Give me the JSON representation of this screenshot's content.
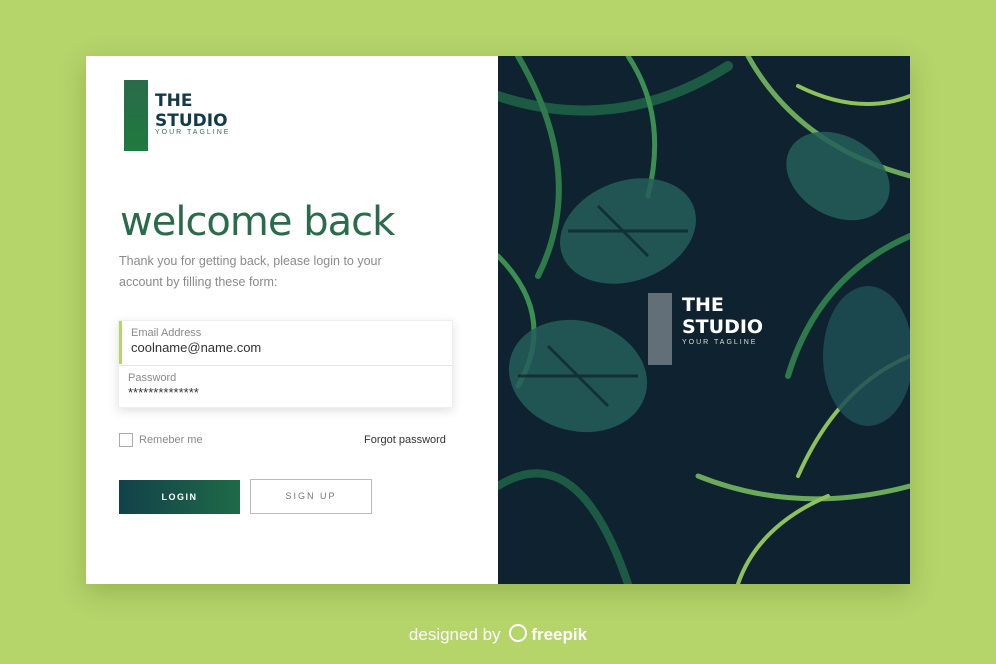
{
  "brand": {
    "title_line1": "THE",
    "title_line2": "STUDIO",
    "tagline": "YOUR TAGLINE"
  },
  "heading": "welcome back",
  "subtitle": "Thank you for getting back, please login to your account by filling these form:",
  "form": {
    "email_label": "Email Address",
    "email_value": "coolname@name.com",
    "password_label": "Password",
    "password_value": "**************"
  },
  "remember_label": "Remeber me",
  "forgot_label": "Forgot password",
  "login_label": "LOGIN",
  "signup_label": "SIGN UP",
  "footer": {
    "prefix": "designed by",
    "brand": "freepik"
  },
  "colors": {
    "background": "#b5d46a",
    "accent": "#2a6b4c",
    "panel_dark": "#0f2230"
  }
}
